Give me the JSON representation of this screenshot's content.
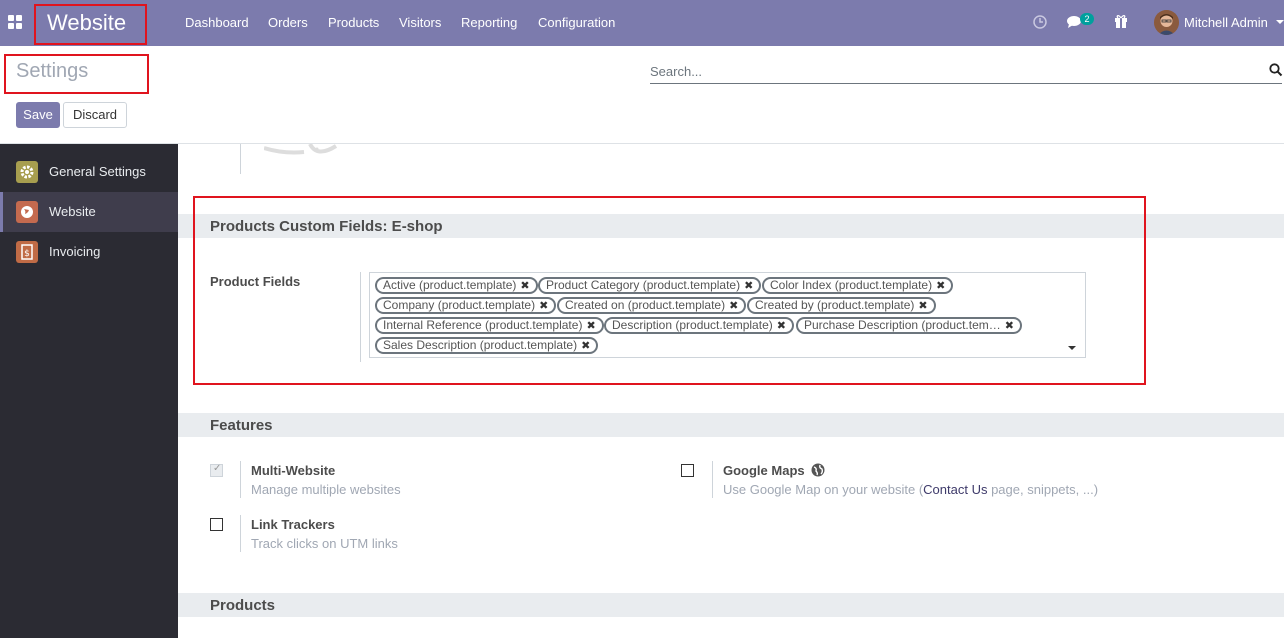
{
  "navbar": {
    "brand": "Website",
    "menu": [
      "Dashboard",
      "Orders",
      "Products",
      "Visitors",
      "Reporting",
      "Configuration"
    ],
    "messages_badge": "2",
    "user_name": "Mitchell Admin"
  },
  "control_panel": {
    "title": "Settings",
    "search_placeholder": "Search...",
    "save_label": "Save",
    "discard_label": "Discard"
  },
  "sidebar": {
    "items": [
      {
        "label": "General Settings",
        "icon": "gear-icon",
        "color": "#a79e4f"
      },
      {
        "label": "Website",
        "icon": "globe-icon",
        "color": "#c46a4f"
      },
      {
        "label": "Invoicing",
        "icon": "invoice-icon",
        "color": "#c06b46"
      }
    ]
  },
  "custom_fields": {
    "section_title": "Products Custom Fields: E-shop",
    "field_label": "Product Fields",
    "tags": [
      "Active (product.template)",
      "Product Category (product.template)",
      "Color Index (product.template)",
      "Company (product.template)",
      "Created on (product.template)",
      "Created by (product.template)",
      "Internal Reference (product.template)",
      "Description (product.template)",
      "Purchase Description (product.tem…",
      "Sales Description (product.template)"
    ]
  },
  "features": {
    "section_title": "Features",
    "multi_website": {
      "title": "Multi-Website",
      "desc": "Manage multiple websites",
      "checked": true
    },
    "google_maps": {
      "title": "Google Maps",
      "desc_before": "Use Google Map on your website (",
      "link": "Contact Us",
      "desc_after": " page, snippets, ...)",
      "checked": false
    },
    "link_trackers": {
      "title": "Link Trackers",
      "desc": "Track clicks on UTM links",
      "checked": false
    }
  },
  "products_section": {
    "section_title": "Products"
  },
  "colors": {
    "accent": "#7c7bad",
    "highlight": "#e0141e",
    "sidebar": "#2b2b33"
  }
}
